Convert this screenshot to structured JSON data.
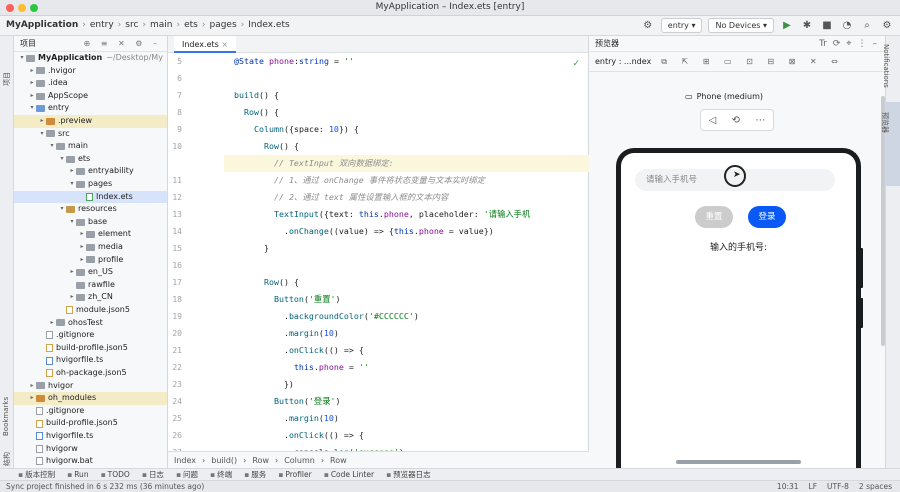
{
  "window": {
    "title": "MyApplication – Index.ets [entry]"
  },
  "breadcrumbs": [
    "MyApplication",
    "entry",
    "src",
    "main",
    "ets",
    "pages",
    "Index.ets"
  ],
  "toolbar": {
    "module": "entry",
    "device": "No Devices"
  },
  "left_stripe": {
    "project": "项目",
    "bookmarks": "Bookmarks",
    "structure": "结构"
  },
  "project": {
    "header": "项目",
    "items": [
      {
        "label": "MyApplication",
        "extra": "~/Desktop/My",
        "indent": 0,
        "icon": "gray",
        "arrow": "▾",
        "bold": true
      },
      {
        "label": ".hvigor",
        "indent": 1,
        "icon": "gray",
        "arrow": "▸"
      },
      {
        "label": ".idea",
        "indent": 1,
        "icon": "gray",
        "arrow": "▸"
      },
      {
        "label": "AppScope",
        "indent": 1,
        "icon": "gray",
        "arrow": "▸"
      },
      {
        "label": "entry",
        "indent": 1,
        "icon": "src",
        "arrow": "▾"
      },
      {
        "label": ".preview",
        "indent": 2,
        "icon": "orange",
        "arrow": "▸",
        "hl": true
      },
      {
        "label": "src",
        "indent": 2,
        "icon": "gray",
        "arrow": "▾"
      },
      {
        "label": "main",
        "indent": 3,
        "icon": "gray",
        "arrow": "▾"
      },
      {
        "label": "ets",
        "indent": 4,
        "icon": "gray",
        "arrow": "▾"
      },
      {
        "label": "entryability",
        "indent": 5,
        "icon": "gray",
        "arrow": "▸"
      },
      {
        "label": "pages",
        "indent": 5,
        "icon": "gray",
        "arrow": "▾"
      },
      {
        "label": "Index.ets",
        "indent": 6,
        "icon": "ets",
        "arrow": "",
        "sel": true
      },
      {
        "label": "resources",
        "indent": 4,
        "icon": "res",
        "arrow": "▾"
      },
      {
        "label": "base",
        "indent": 5,
        "icon": "gray",
        "arrow": "▾"
      },
      {
        "label": "element",
        "indent": 6,
        "icon": "gray",
        "arrow": "▸"
      },
      {
        "label": "media",
        "indent": 6,
        "icon": "gray",
        "arrow": "▸"
      },
      {
        "label": "profile",
        "indent": 6,
        "icon": "gray",
        "arrow": "▸"
      },
      {
        "label": "en_US",
        "indent": 5,
        "icon": "gray",
        "arrow": "▸"
      },
      {
        "label": "rawfile",
        "indent": 5,
        "icon": "gray",
        "arrow": ""
      },
      {
        "label": "zh_CN",
        "indent": 5,
        "icon": "gray",
        "arrow": "▸"
      },
      {
        "label": "module.json5",
        "indent": 4,
        "icon": "json",
        "arrow": ""
      },
      {
        "label": "ohosTest",
        "indent": 3,
        "icon": "gray",
        "arrow": "▸"
      },
      {
        "label": ".gitignore",
        "indent": 2,
        "icon": "file",
        "arrow": ""
      },
      {
        "label": "build-profile.json5",
        "indent": 2,
        "icon": "json",
        "arrow": ""
      },
      {
        "label": "hvigorfile.ts",
        "indent": 2,
        "icon": "ts",
        "arrow": ""
      },
      {
        "label": "oh-package.json5",
        "indent": 2,
        "icon": "json",
        "arrow": ""
      },
      {
        "label": "hvigor",
        "indent": 1,
        "icon": "gray",
        "arrow": "▸"
      },
      {
        "label": "oh_modules",
        "indent": 1,
        "icon": "orange",
        "arrow": "▸",
        "hl": true
      },
      {
        "label": ".gitignore",
        "indent": 1,
        "icon": "file",
        "arrow": ""
      },
      {
        "label": "build-profile.json5",
        "indent": 1,
        "icon": "json",
        "arrow": ""
      },
      {
        "label": "hvigorfile.ts",
        "indent": 1,
        "icon": "ts",
        "arrow": ""
      },
      {
        "label": "hvigorw",
        "indent": 1,
        "icon": "file",
        "arrow": ""
      },
      {
        "label": "hvigorw.bat",
        "indent": 1,
        "icon": "file",
        "arrow": ""
      }
    ]
  },
  "editor": {
    "tab": "Index.ets",
    "lines": [
      {
        "n": "5",
        "html": "  <span class='kw'>@State</span> <span class='prop'>phone</span>:<span class='kw'>string</span> = <span class='st'>''</span>"
      },
      {
        "n": "6",
        "html": ""
      },
      {
        "n": "7",
        "html": "  <span class='fn'>build</span>() {"
      },
      {
        "n": "8",
        "html": "    <span class='fn'>Row</span>() {"
      },
      {
        "n": "9",
        "html": "      <span class='fn'>Column</span>({space: <span class='num'>10</span>}) {"
      },
      {
        "n": "10",
        "html": "        <span class='fn'>Row</span>() {"
      },
      {
        "n": "",
        "html": "          <span class='cm'>// TextInput 双向数据绑定:</span>",
        "cur": true
      },
      {
        "n": "11",
        "html": "          <span class='cm'>// 1、通过 onChange 事件将状态变量与文本实时绑定</span>"
      },
      {
        "n": "12",
        "html": "          <span class='cm'>// 2、通过 text 属性设置输入框的文本内容</span>"
      },
      {
        "n": "13",
        "html": "          <span class='fn'>TextInput</span>({text: <span class='kw'>this</span>.<span class='prop'>phone</span>, placeholder: <span class='st'>'请输入手机</span>"
      },
      {
        "n": "14",
        "html": "            .<span class='fn'>onChange</span>((value) => {<span class='kw'>this</span>.<span class='prop'>phone</span> = value})"
      },
      {
        "n": "15",
        "html": "        }"
      },
      {
        "n": "16",
        "html": ""
      },
      {
        "n": "17",
        "html": "        <span class='fn'>Row</span>() {"
      },
      {
        "n": "18",
        "html": "          <span class='fn'>Button</span>(<span class='st'>'重置'</span>)"
      },
      {
        "n": "19",
        "html": "            .<span class='fn'>backgroundColor</span>(<span class='st'>'#CCCCCC'</span>)"
      },
      {
        "n": "20",
        "html": "            .<span class='fn'>margin</span>(<span class='num'>10</span>)"
      },
      {
        "n": "21",
        "html": "            .<span class='fn'>onClick</span>(() => {"
      },
      {
        "n": "22",
        "html": "              <span class='kw'>this</span>.<span class='prop'>phone</span> = <span class='st'>''</span>"
      },
      {
        "n": "23",
        "html": "            })"
      },
      {
        "n": "24",
        "html": "          <span class='fn'>Button</span>(<span class='st'>'登录'</span>)"
      },
      {
        "n": "25",
        "html": "            .<span class='fn'>margin</span>(<span class='num'>10</span>)"
      },
      {
        "n": "26",
        "html": "            .<span class='fn'>onClick</span>(() => {"
      },
      {
        "n": "27",
        "html": "              console.<span class='fn'>log</span>(<span class='st'>'success'</span>)"
      }
    ],
    "statusbar": [
      "Index",
      "build()",
      "Row",
      "Column",
      "Row"
    ]
  },
  "previewer": {
    "title": "预览器",
    "target": "entry : ...ndex",
    "device_label": "Phone (medium)",
    "phone": {
      "input_placeholder": "请输入手机号",
      "reset_button": "重置",
      "login_button": "登录",
      "text": "输入的手机号:"
    }
  },
  "right_stripe": {
    "notifications": "Notifications",
    "previewer": "预览器"
  },
  "toolwindows": [
    "版本控制",
    "Run",
    "TODO",
    "日志",
    "问题",
    "终端",
    "服务",
    "Profiler",
    "Code Linter",
    "预览器日志"
  ],
  "statusline": {
    "message": "Sync project finished in 6 s 232 ms (36 minutes ago)",
    "right": [
      "10:31",
      "LF",
      "UTF-8",
      "2 spaces"
    ]
  }
}
